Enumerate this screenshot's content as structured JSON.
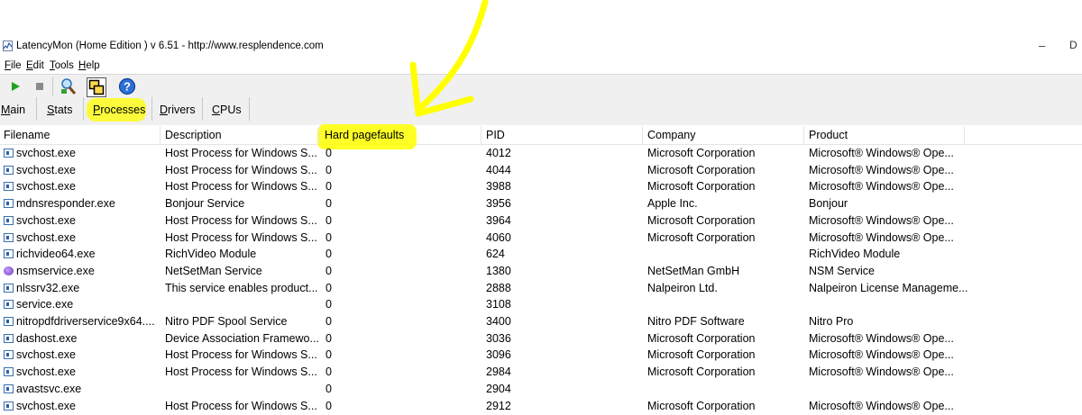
{
  "window": {
    "title": "LatencyMon  (Home Edition )  v 6.51 - http://www.resplendence.com",
    "min_glyph": "–",
    "max_glyph": "D"
  },
  "menu": [
    {
      "pre": "",
      "u": "F",
      "post": "ile"
    },
    {
      "pre": "",
      "u": "E",
      "post": "dit"
    },
    {
      "pre": "",
      "u": "T",
      "post": "ools"
    },
    {
      "pre": "",
      "u": "H",
      "post": "elp"
    }
  ],
  "toolbar": {
    "icons": [
      "play-icon",
      "stop-icon",
      "magnifier-icon",
      "windows-icon",
      "help-icon"
    ]
  },
  "tabs": [
    {
      "pre": "",
      "u": "M",
      "post": "ain"
    },
    {
      "pre": "",
      "u": "S",
      "post": "tats"
    },
    {
      "pre": "",
      "u": "P",
      "post": "rocesses",
      "active": true
    },
    {
      "pre": "",
      "u": "D",
      "post": "rivers"
    },
    {
      "pre": "",
      "u": "C",
      "post": "PUs"
    }
  ],
  "table": {
    "columns": [
      "Filename",
      "Description",
      "Hard pagefaults",
      "PID",
      "Company",
      "Product"
    ],
    "rows": [
      [
        "svchost.exe",
        "Host Process for Windows S...",
        "0",
        "4012",
        "Microsoft Corporation",
        "Microsoft® Windows® Ope..."
      ],
      [
        "svchost.exe",
        "Host Process for Windows S...",
        "0",
        "4044",
        "Microsoft Corporation",
        "Microsoft® Windows® Ope..."
      ],
      [
        "svchost.exe",
        "Host Process for Windows S...",
        "0",
        "3988",
        "Microsoft Corporation",
        "Microsoft® Windows® Ope..."
      ],
      [
        "mdnsresponder.exe",
        "Bonjour Service",
        "0",
        "3956",
        "Apple Inc.",
        "Bonjour"
      ],
      [
        "svchost.exe",
        "Host Process for Windows S...",
        "0",
        "3964",
        "Microsoft Corporation",
        "Microsoft® Windows® Ope..."
      ],
      [
        "svchost.exe",
        "Host Process for Windows S...",
        "0",
        "4060",
        "Microsoft Corporation",
        "Microsoft® Windows® Ope..."
      ],
      [
        "richvideo64.exe",
        "RichVideo Module",
        "0",
        "624",
        "",
        "RichVideo Module"
      ],
      [
        "nsmservice.exe",
        "NetSetMan Service",
        "0",
        "1380",
        "NetSetMan GmbH",
        "NSM Service"
      ],
      [
        "nlssrv32.exe",
        "This service enables product...",
        "0",
        "2888",
        "Nalpeiron Ltd.",
        "Nalpeiron License Manageme..."
      ],
      [
        "service.exe",
        "",
        "0",
        "3108",
        "",
        ""
      ],
      [
        "nitropdfdriverservice9x64....",
        "Nitro PDF Spool Service",
        "0",
        "3400",
        "Nitro PDF Software",
        "Nitro Pro"
      ],
      [
        "dashost.exe",
        "Device Association Framewo...",
        "0",
        "3036",
        "Microsoft Corporation",
        "Microsoft® Windows® Ope..."
      ],
      [
        "svchost.exe",
        "Host Process for Windows S...",
        "0",
        "3096",
        "Microsoft Corporation",
        "Microsoft® Windows® Ope..."
      ],
      [
        "svchost.exe",
        "Host Process for Windows S...",
        "0",
        "2984",
        "Microsoft Corporation",
        "Microsoft® Windows® Ope..."
      ],
      [
        "avastsvc.exe",
        "",
        "0",
        "2904",
        "",
        ""
      ],
      [
        "svchost.exe",
        "Host Process for Windows S...",
        "0",
        "2912",
        "Microsoft Corporation",
        "Microsoft® Windows® Ope..."
      ]
    ],
    "row_icons": [
      "process-icon",
      "process-icon",
      "process-icon",
      "process-icon",
      "process-icon",
      "process-icon",
      "process-icon",
      "nsm-icon",
      "process-icon",
      "process-icon",
      "process-icon",
      "process-icon",
      "process-icon",
      "process-icon",
      "process-icon",
      "process-icon"
    ]
  },
  "annotation": {
    "highlight_color": "#ffff00"
  }
}
